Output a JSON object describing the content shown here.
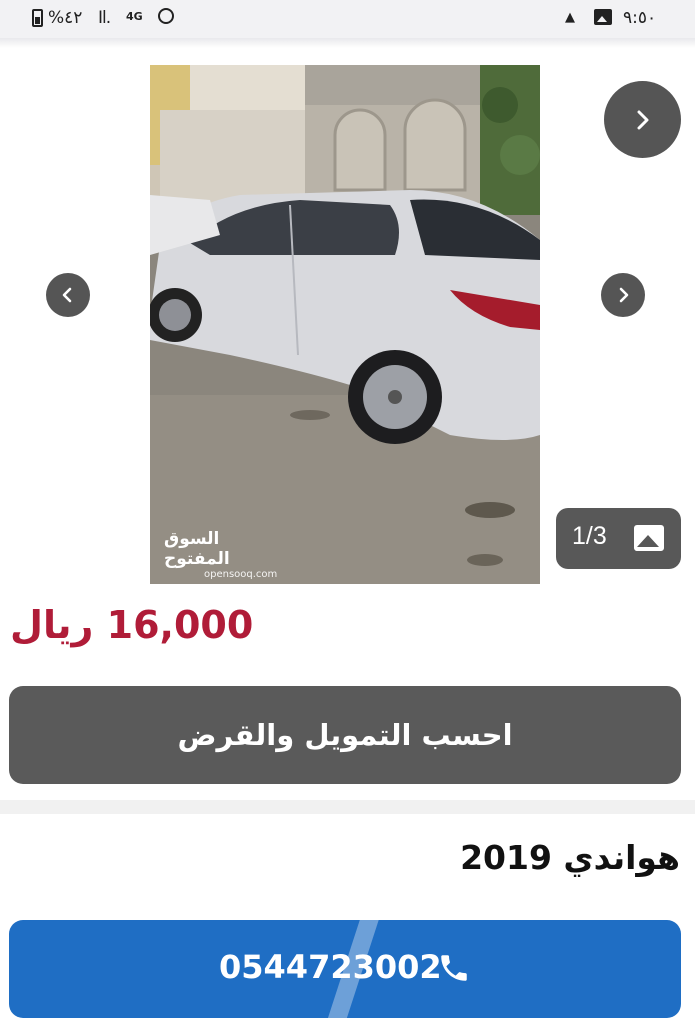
{
  "status_bar": {
    "time": "٩:٥٠",
    "battery": "%٤٢",
    "network": "4G"
  },
  "listing": {
    "image_counter": "1/3",
    "watermark_ar": "السوق المفتوح",
    "watermark_en": "opensooq.com",
    "price": "16,000 ريال",
    "finance_button": "احسب التمويل والقرض",
    "title": "هواندي 2019",
    "phone": "0544723002"
  },
  "icons": {
    "next_top": "chevron-right-icon",
    "prev": "chevron-left-icon",
    "next": "chevron-right-icon",
    "gallery": "image-icon",
    "call": "phone-icon"
  },
  "colors": {
    "price": "#b01c38",
    "finance_button_bg": "#5a5a5a",
    "call_button_bg": "#1f6ec4"
  }
}
